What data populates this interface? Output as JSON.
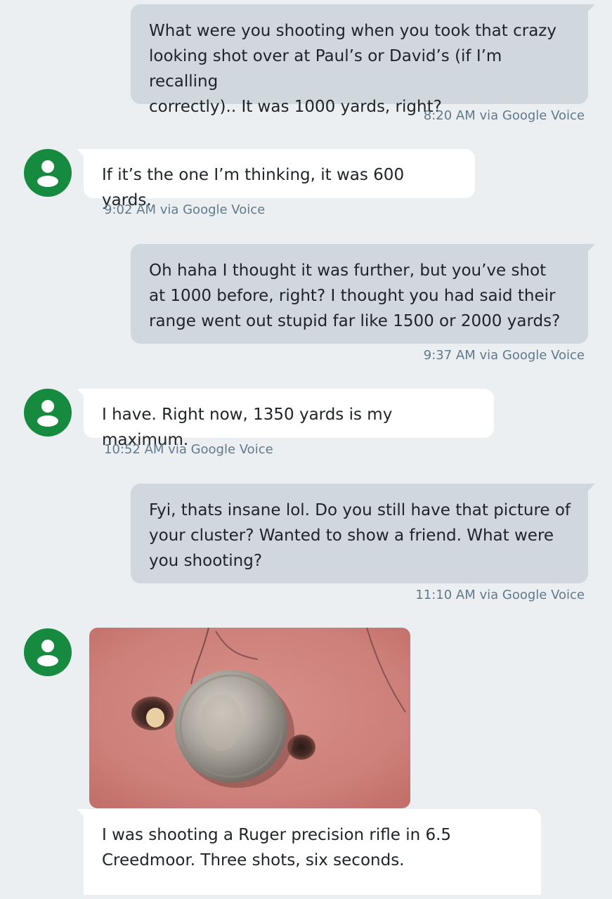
{
  "conversation": {
    "messages": [
      {
        "direction": "outgoing",
        "text": "What were you shooting when you took that crazy\nlooking shot over at Paul’s or David’s (if I’m recalling\ncorrectly).. It was 1000 yards, right?",
        "meta": "8:20 AM via Google Voice"
      },
      {
        "direction": "incoming",
        "text": "If it’s the one I’m thinking, it was 600 yards.",
        "meta": "9:02 AM via Google Voice"
      },
      {
        "direction": "outgoing",
        "text": "Oh haha I thought it was further, but you’ve shot\nat 1000 before, right? I thought you had said their\nrange went out stupid far like 1500 or 2000 yards?",
        "meta": "9:37 AM via Google Voice"
      },
      {
        "direction": "incoming",
        "text": "I have. Right now, 1350 yards is my maximum.",
        "meta": "10:52 AM via Google Voice"
      },
      {
        "direction": "outgoing",
        "text": "Fyi, thats insane lol. Do you still have that picture of\nyour cluster? Wanted to show a friend. What were\nyou shooting?",
        "meta": "11:10 AM via Google Voice"
      },
      {
        "direction": "incoming",
        "text": "I was shooting a Ruger precision rifle in 6.5\nCreedmoor. Three shots, six seconds."
      }
    ]
  },
  "icons": {
    "avatar": "person-icon",
    "photo": "target-photo-with-coin"
  },
  "colors": {
    "background": "#eceff2",
    "outgoing_bubble": "#d0d8de",
    "incoming_bubble": "#ffffff",
    "avatar": "#168a3f",
    "meta_text": "#61798a"
  }
}
